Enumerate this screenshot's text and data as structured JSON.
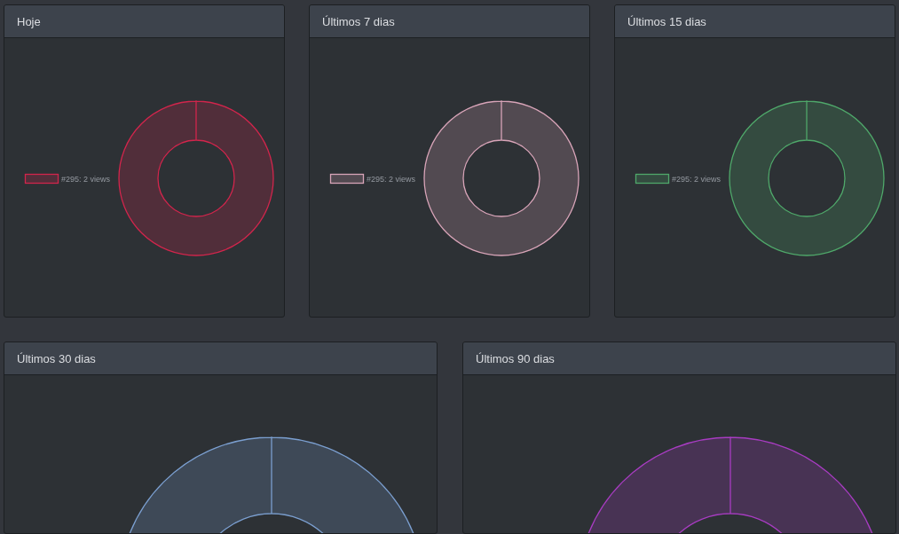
{
  "panels": [
    {
      "title": "Hoje",
      "legend": "#295: 2 views",
      "donut": {
        "color": "#d2254c"
      }
    },
    {
      "title": "Últimos 7 dias",
      "legend": "#295: 2 views",
      "donut": {
        "color": "#d8a4b8"
      }
    },
    {
      "title": "Últimos 15 dias",
      "legend": "#295: 2 views",
      "donut": {
        "color": "#4fa86a"
      }
    },
    {
      "title": "Últimos 30 dias",
      "donut": {
        "color": "#7b9fd0"
      }
    },
    {
      "title": "Últimos 90 dias",
      "donut": {
        "color": "#a83cc2"
      }
    }
  ]
}
